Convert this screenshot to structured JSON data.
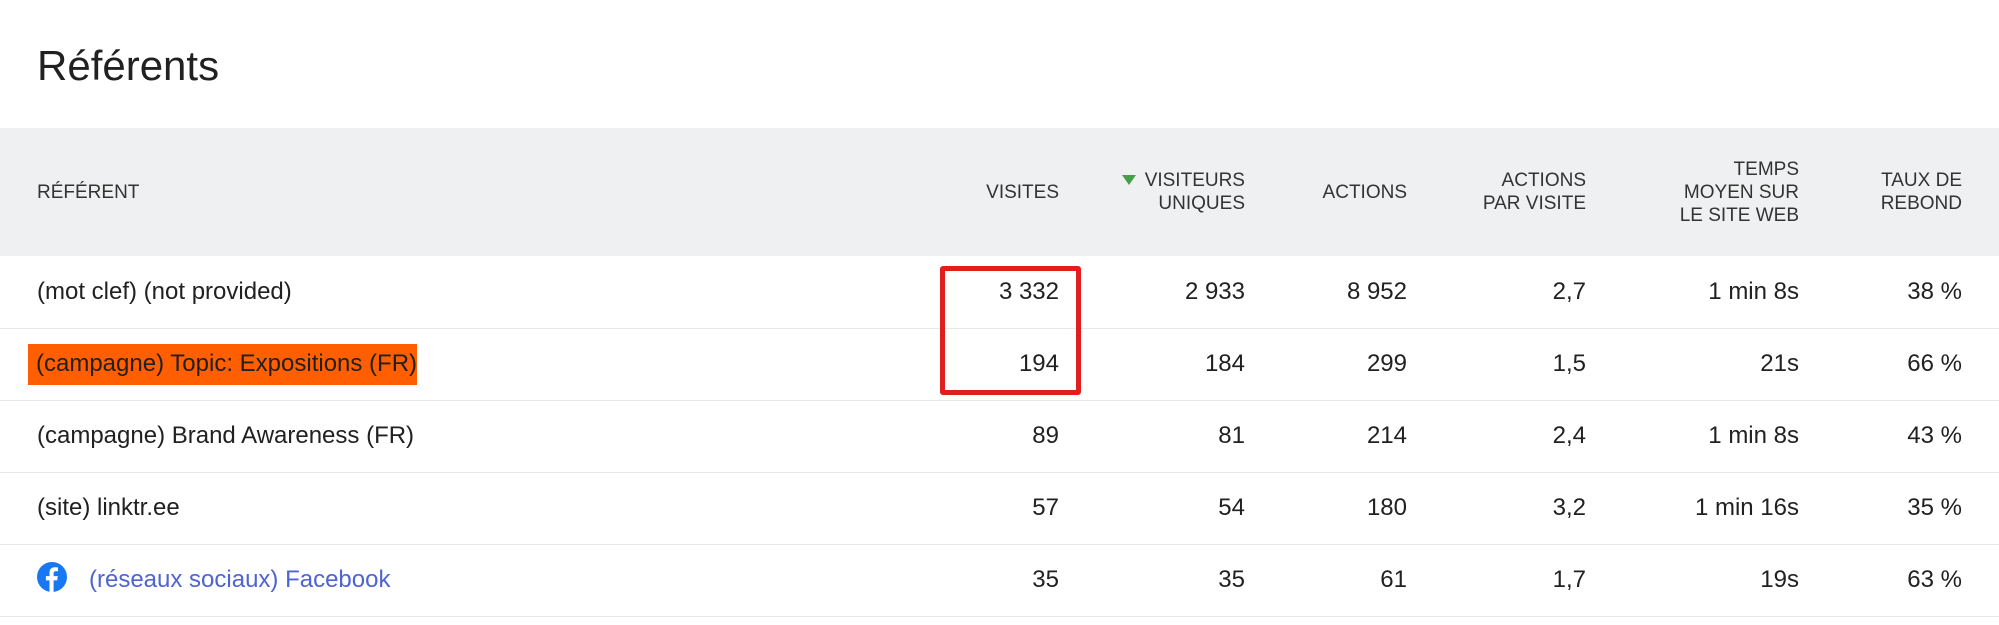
{
  "page": {
    "title": "Référents"
  },
  "table": {
    "columns": [
      {
        "key": "label",
        "label": "RÉFÉRENT"
      },
      {
        "key": "visits",
        "label": "VISITES"
      },
      {
        "key": "unique_visitors",
        "label": "VISITEURS\nUNIQUES",
        "sorted": "desc"
      },
      {
        "key": "actions",
        "label": "ACTIONS"
      },
      {
        "key": "actions_per_visit",
        "label": "ACTIONS\nPAR VISITE"
      },
      {
        "key": "avg_time",
        "label": "TEMPS\nMOYEN SUR\nLE SITE WEB"
      },
      {
        "key": "bounce_rate",
        "label": "TAUX DE\nREBOND"
      }
    ],
    "rows": [
      {
        "label": "(mot clef) (not provided)",
        "visits": "3 332",
        "unique_visitors": "2 933",
        "actions": "8 952",
        "actions_per_visit": "2,7",
        "avg_time": "1 min 8s",
        "bounce_rate": "38 %"
      },
      {
        "label": "(campagne) Topic: Expositions (FR)",
        "visits": "194",
        "unique_visitors": "184",
        "actions": "299",
        "actions_per_visit": "1,5",
        "avg_time": "21s",
        "bounce_rate": "66 %"
      },
      {
        "label": "(campagne) Brand Awareness (FR)",
        "visits": "89",
        "unique_visitors": "81",
        "actions": "214",
        "actions_per_visit": "2,4",
        "avg_time": "1 min 8s",
        "bounce_rate": "43 %"
      },
      {
        "label": "(site) linktr.ee",
        "visits": "57",
        "unique_visitors": "54",
        "actions": "180",
        "actions_per_visit": "3,2",
        "avg_time": "1 min 16s",
        "bounce_rate": "35 %"
      },
      {
        "label": "(réseaux sociaux) Facebook",
        "icon": "facebook-icon",
        "visits": "35",
        "unique_visitors": "35",
        "actions": "61",
        "actions_per_visit": "1,7",
        "avg_time": "19s",
        "bounce_rate": "63 %"
      }
    ]
  },
  "colors": {
    "header_bg": "#eff0f1",
    "highlight": "#ff5f00",
    "annotation": "#e11d1d",
    "link": "#4f63d2",
    "sort_indicator": "#43a047",
    "facebook": "#1877f2"
  }
}
